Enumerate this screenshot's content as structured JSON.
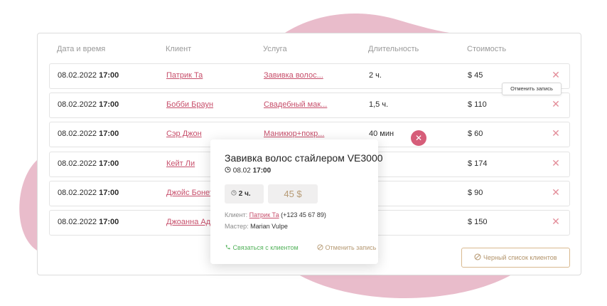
{
  "colors": {
    "accent": "#c74f6b",
    "blob": "#e9bccb",
    "gold": "#b69a74",
    "green": "#52b25a"
  },
  "table": {
    "headers": [
      "Дата и время",
      "Клиент",
      "Услуга",
      "Длительность",
      "Стоимость"
    ],
    "rows": [
      {
        "date": "08.02.2022",
        "time": "17:00",
        "client": "Патрик Та",
        "service": "Завивка волос...",
        "duration": "2 ч.",
        "price": "$ 45"
      },
      {
        "date": "08.02.2022",
        "time": "17:00",
        "client": "Бобби Браун",
        "service": "Свадебный мак...",
        "duration": "1,5 ч.",
        "price": "$ 110"
      },
      {
        "date": "08.02.2022",
        "time": "17:00",
        "client": "Сэр Джон",
        "service": "Маникюр+покр...",
        "duration": "40 мин",
        "price": "$ 60"
      },
      {
        "date": "08.02.2022",
        "time": "17:00",
        "client": "Кейт Ли",
        "service": "",
        "duration": "",
        "price": "$ 174"
      },
      {
        "date": "08.02.2022",
        "time": "17:00",
        "client": "Джойс Бонет",
        "service": "",
        "duration": "",
        "price": "$ 90"
      },
      {
        "date": "08.02.2022",
        "time": "17:00",
        "client": "Джоанна Ад",
        "service": "",
        "duration": "",
        "price": "$ 150"
      }
    ],
    "row_delete_icon": "close-icon"
  },
  "tooltip": {
    "text": "Отменить запись"
  },
  "blacklist_button": {
    "label": "Черный список клиентов",
    "icon": "ban-icon"
  },
  "popup": {
    "title": "Завивка волос стайлером VE3000",
    "date": "08.02",
    "time": "17:00",
    "duration": "2 ч.",
    "price": "45 $",
    "client_label": "Клиент:",
    "client_name": "Патрик Та",
    "client_phone": "(+123 45 67 89)",
    "master_label": "Мастер:",
    "master_name": "Marian Vulpe",
    "contact_label": "Связаться с клиентом",
    "cancel_label": "Отменить запись",
    "close_icon": "close-icon"
  }
}
